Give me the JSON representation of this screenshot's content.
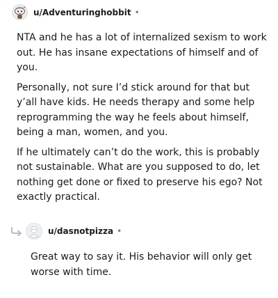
{
  "comments": [
    {
      "username": "u/Adventuringhobbit",
      "separator": "•",
      "avatar_icon": "snoo-avatar-icon",
      "paragraphs": [
        "NTA and he has a lot of internalized sexism to work out. He has insane expectations of himself and of you.",
        "Personally, not sure I’d stick around for that but y’all have kids. He needs therapy and some help reprogramming the way he feels about himself, being a man, women, and you.",
        "If he ultimately can’t do the work, this is probably not sustainable. What are you supposed to do, let nothing get done or fixed to preserve his ego? Not exactly practical."
      ]
    },
    {
      "username": "u/dasnotpizza",
      "separator": "•",
      "avatar_icon": "default-avatar-icon",
      "reply_icon": "reply-arrow-icon",
      "paragraphs": [
        "Great way to say it. His behavior will only get worse with time."
      ]
    }
  ],
  "colors": {
    "text": "#1a1a1b",
    "meta": "#7c7c7c",
    "avatar_bg": "#e9eef2"
  }
}
